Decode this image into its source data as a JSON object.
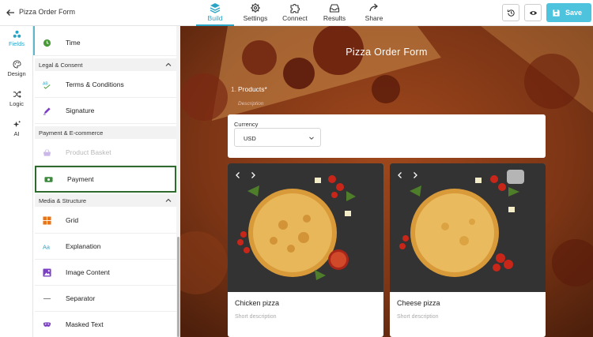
{
  "app": {
    "title": "Pizza Order Form"
  },
  "nav": [
    {
      "label": "Build",
      "active": true
    },
    {
      "label": "Settings"
    },
    {
      "label": "Connect"
    },
    {
      "label": "Results"
    },
    {
      "label": "Share"
    }
  ],
  "toolbar": {
    "save_label": "Save",
    "accent": "#4ec3dd"
  },
  "rail": [
    {
      "label": "Fields",
      "active": true,
      "icon": "fields-icon"
    },
    {
      "label": "Design",
      "icon": "palette-icon"
    },
    {
      "label": "Logic",
      "icon": "shuffle-icon"
    },
    {
      "label": "AI",
      "icon": "sparkle-icon"
    }
  ],
  "panel": {
    "items": [
      {
        "type": "field",
        "label": "Time",
        "icon": "clock-icon"
      },
      {
        "type": "section",
        "label": "Legal & Consent"
      },
      {
        "type": "field",
        "label": "Terms & Conditions",
        "icon": "terms-icon"
      },
      {
        "type": "field",
        "label": "Signature",
        "icon": "pen-icon"
      },
      {
        "type": "section",
        "label": "Payment & E-commerce"
      },
      {
        "type": "field",
        "label": "Product Basket",
        "icon": "basket-icon",
        "disabled": true
      },
      {
        "type": "field",
        "label": "Payment",
        "icon": "payment-icon",
        "selected": true
      },
      {
        "type": "section",
        "label": "Media & Structure"
      },
      {
        "type": "field",
        "label": "Grid",
        "icon": "grid-icon"
      },
      {
        "type": "field",
        "label": "Explanation",
        "icon": "text-icon"
      },
      {
        "type": "field",
        "label": "Image Content",
        "icon": "image-icon"
      },
      {
        "type": "field",
        "label": "Separator",
        "icon": "separator-icon"
      },
      {
        "type": "field",
        "label": "Masked Text",
        "icon": "mask-icon"
      }
    ]
  },
  "form": {
    "title": "Pizza Order Form",
    "question": {
      "number": "1.",
      "title": "Products*",
      "description": "Description"
    },
    "currency": {
      "label": "Currency",
      "value": "USD"
    },
    "products": [
      {
        "name": "Chicken pizza",
        "description": "Short description"
      },
      {
        "name": "Cheese pizza",
        "description": "Short description"
      }
    ]
  }
}
